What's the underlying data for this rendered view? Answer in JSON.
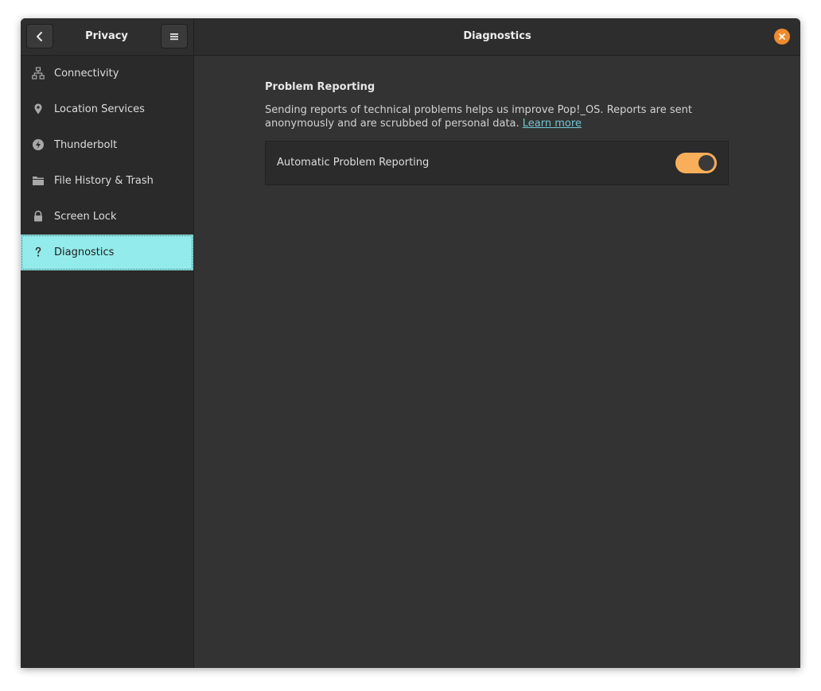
{
  "header": {
    "sidebar_title": "Privacy",
    "title": "Diagnostics"
  },
  "icons": {
    "back": "chevron-left-icon",
    "menu": "hamburger-menu-icon",
    "close": "close-icon"
  },
  "sidebar": {
    "items": [
      {
        "label": "Connectivity",
        "icon": "network-icon"
      },
      {
        "label": "Location Services",
        "icon": "map-pin-icon"
      },
      {
        "label": "Thunderbolt",
        "icon": "thunderbolt-icon"
      },
      {
        "label": "File History & Trash",
        "icon": "folder-icon"
      },
      {
        "label": "Screen Lock",
        "icon": "lock-icon"
      },
      {
        "label": "Diagnostics",
        "icon": "question-icon",
        "active": true
      }
    ]
  },
  "main": {
    "section_title": "Problem Reporting",
    "description": "Sending reports of technical problems helps us improve Pop!_OS. Reports are sent anonymously and are scrubbed of personal data.",
    "learn_more": "Learn more",
    "rows": [
      {
        "label": "Automatic Problem Reporting",
        "enabled": true
      }
    ]
  },
  "colors": {
    "accent": "#f9ae59",
    "selection": "#94ebeb",
    "close": "#ef8a2e",
    "link": "#72c6d2"
  }
}
